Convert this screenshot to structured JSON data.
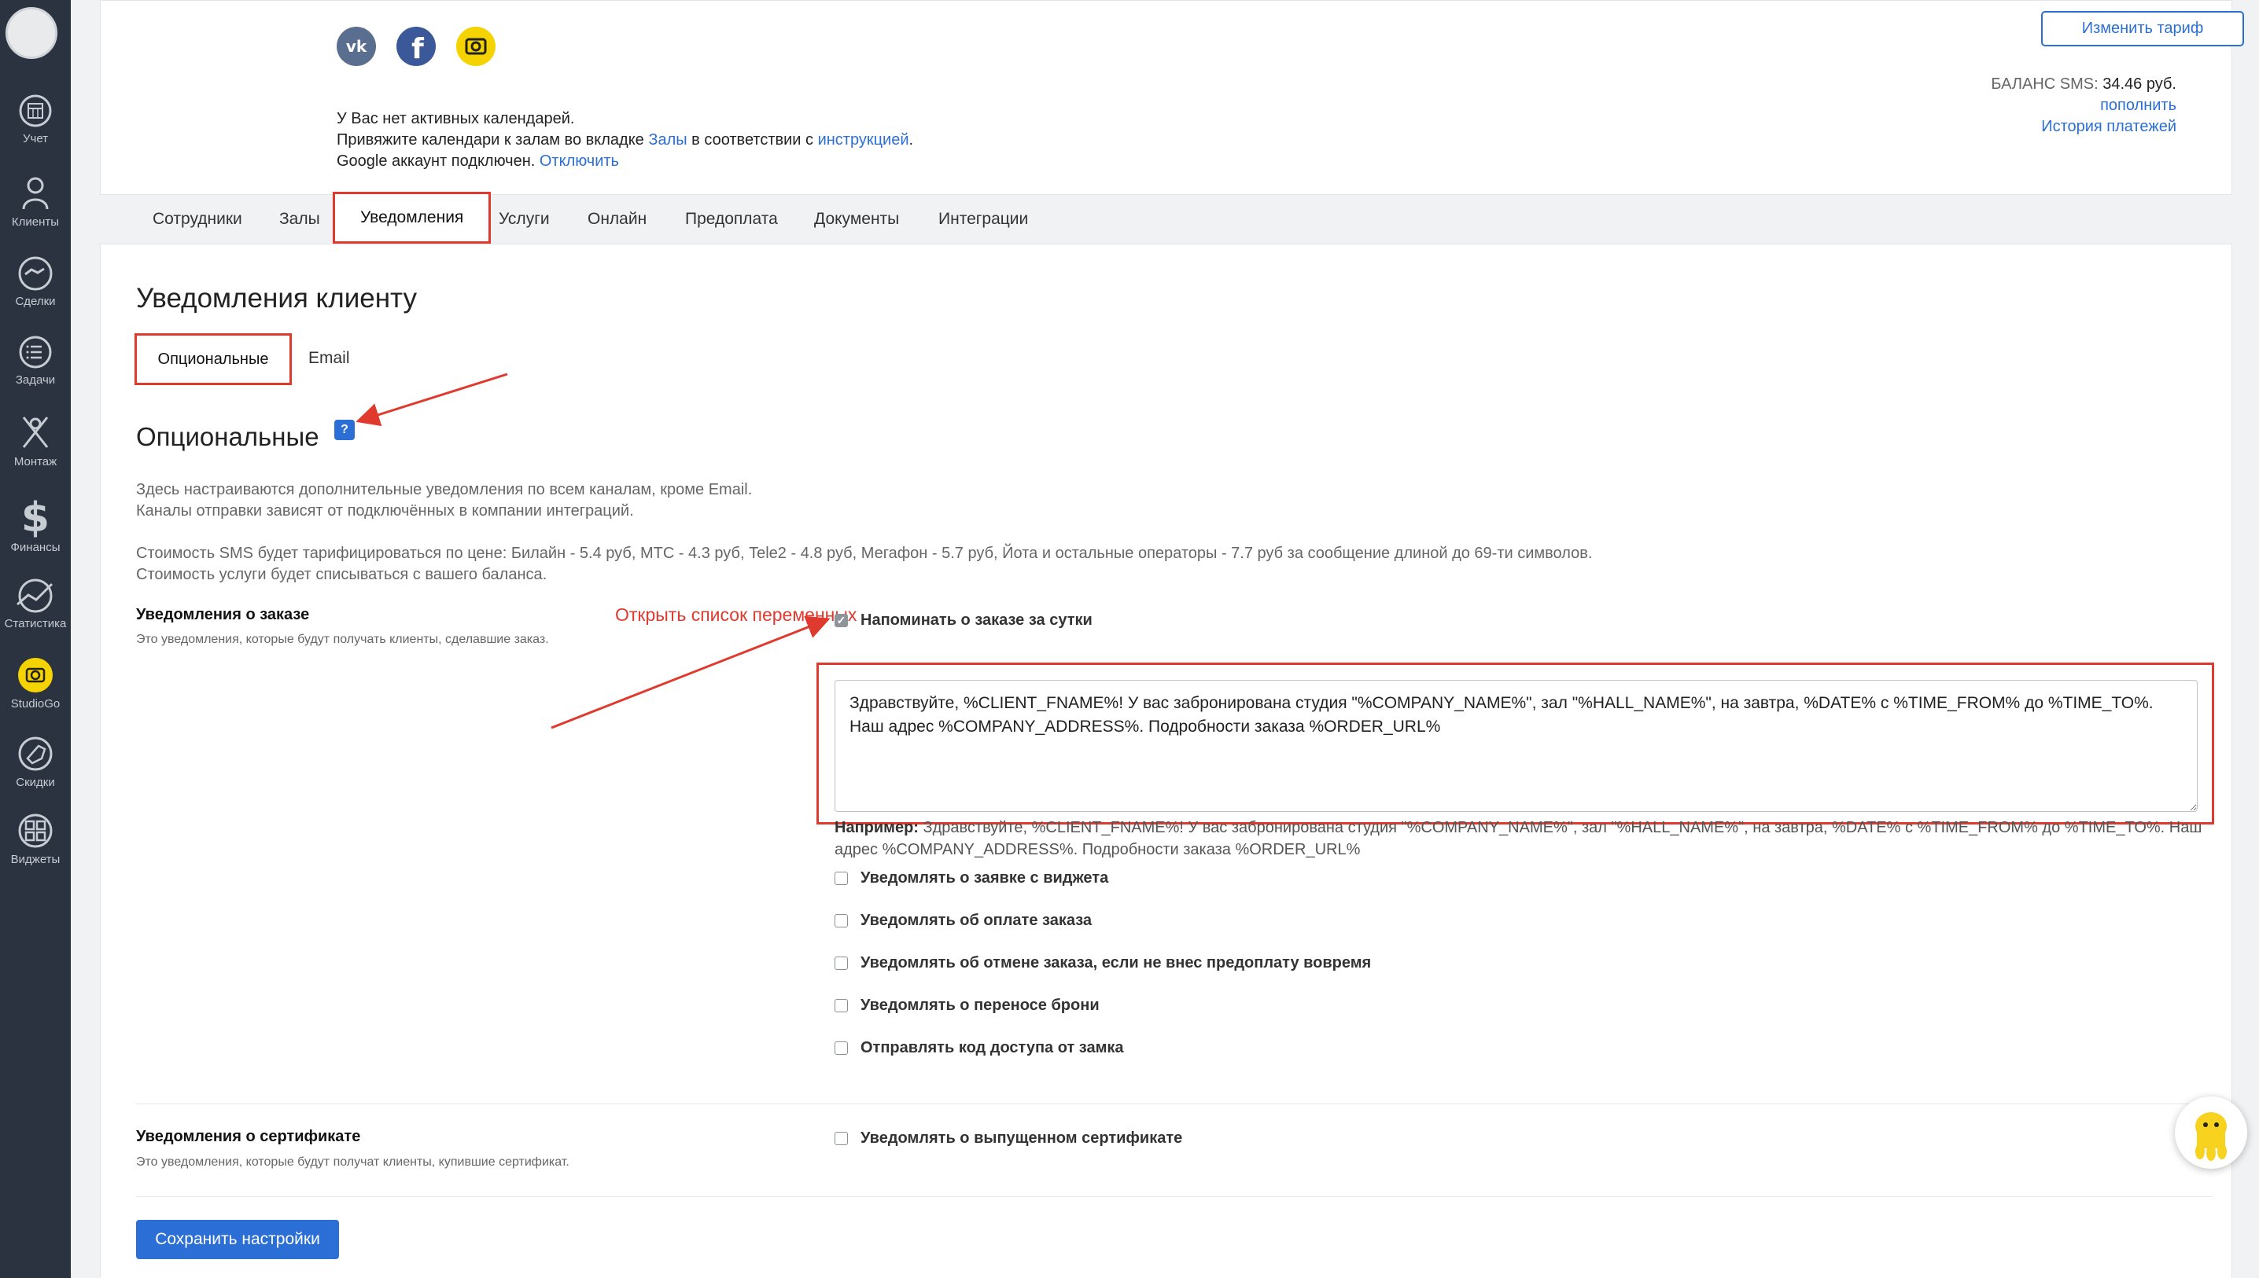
{
  "sidebar": {
    "items": [
      {
        "label": "Учет",
        "icon": "calendar-icon"
      },
      {
        "label": "Клиенты",
        "icon": "user-icon"
      },
      {
        "label": "Сделки",
        "icon": "handshake-icon"
      },
      {
        "label": "Задачи",
        "icon": "checklist-icon"
      },
      {
        "label": "Монтаж",
        "icon": "tools-icon"
      },
      {
        "label": "Финансы",
        "icon": "dollar-icon"
      },
      {
        "label": "Статистика",
        "icon": "chart-icon"
      },
      {
        "label": "StudioGo",
        "icon": "studiogo-icon"
      },
      {
        "label": "Скидки",
        "icon": "tag-icon"
      },
      {
        "label": "Виджеты",
        "icon": "widgets-icon"
      }
    ]
  },
  "header": {
    "calendars_line": "У Вас нет активных календарей.",
    "bind_prefix": "Привяжите календари к залам во вкладке ",
    "bind_link_halls": "Залы",
    "bind_middle": " в соответствии с ",
    "bind_link_instructions": "инструкцией",
    "bind_suffix": ".",
    "google_text": "Google аккаунт подключен. ",
    "google_disconnect": "Отключить",
    "change_tariff": "Изменить тариф",
    "balance_label": "БАЛАНС SMS: ",
    "balance_value": "34.46 руб.",
    "topup": "пополнить",
    "payment_history": "История платежей"
  },
  "tabs": [
    "Сотрудники",
    "Залы",
    "Уведомления",
    "Услуги",
    "Онлайн",
    "Предоплата",
    "Документы",
    "Интеграции"
  ],
  "main": {
    "title": "Уведомления клиенту",
    "subtabs": [
      "Опциональные",
      "Email"
    ],
    "annotation": "Открыть список переменных",
    "section_title": "Опциональные",
    "help": "?",
    "desc1": "Здесь настраиваются дополнительные уведомления по всем каналам, кроме Email.",
    "desc2": "Каналы отправки зависят от подключённых в компании интеграций.",
    "desc3": "Стоимость SMS будет тарифицироваться по цене: Билайн - 5.4 руб, МТС - 4.3 руб, Tele2 - 4.8 руб, Мегафон - 5.7 руб, Йота и остальные операторы - 7.7 руб за сообщение длиной до 69-ти символов.",
    "desc4": "Стоимость услуги будет списываться с вашего баланса.",
    "order_group_title": "Уведомления о заказе",
    "order_group_sub": "Это уведомления, которые будут получать клиенты, сделавшие заказ.",
    "remind_label": "Напоминать о заказе за сутки",
    "remind_text": "Здравствуйте, %CLIENT_FNAME%! У вас забронирована студия \"%COMPANY_NAME%\", зал \"%HALL_NAME%\", на завтра, %DATE% с %TIME_FROM% до %TIME_TO%. Наш адрес %COMPANY_ADDRESS%. Подробности заказа %ORDER_URL%",
    "example_label": "Например:",
    "example_text": " Здравствуйте, %CLIENT_FNAME%! У вас забронирована студия \"%COMPANY_NAME%\", зал \"%HALL_NAME%\", на завтра, %DATE% с %TIME_FROM% до %TIME_TO%. Наш адрес %COMPANY_ADDRESS%. Подробности заказа %ORDER_URL%",
    "options": [
      {
        "label": "Уведомлять о заявке с виджета",
        "checked": false
      },
      {
        "label": "Уведомлять об оплате заказа",
        "checked": false
      },
      {
        "label": "Уведомлять об отмене заказа, если не внес предоплату вовремя",
        "checked": false
      },
      {
        "label": "Уведомлять о переносе брони",
        "checked": false
      },
      {
        "label": "Отправлять код доступа от замка",
        "checked": false
      }
    ],
    "cert_group_title": "Уведомления о сертификате",
    "cert_group_sub": "Это уведомления, которые будут получат клиенты, купившие сертификат.",
    "cert_option": "Уведомлять о выпущенном сертификате",
    "save": "Сохранить настройки"
  },
  "colors": {
    "accent": "#2b6fd6",
    "annotation": "#e03a2f",
    "sidebar": "#2b3340"
  }
}
